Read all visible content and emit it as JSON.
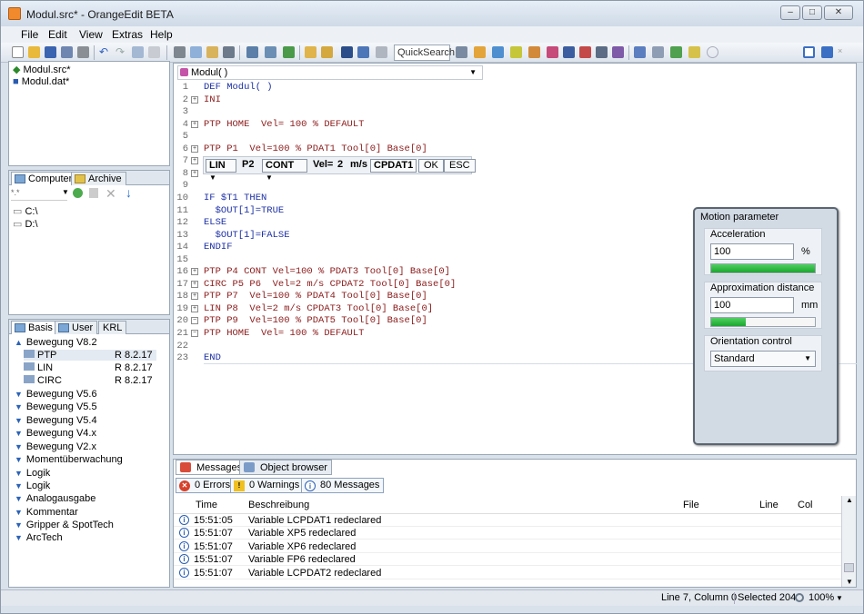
{
  "title": "Modul.src* - OrangeEdit BETA",
  "menu": [
    "File",
    "Edit",
    "View",
    "Extras",
    "Help"
  ],
  "toolbar": {
    "quicksearch": "QuickSearch"
  },
  "files": [
    "Modul.src*",
    "Modul.dat*"
  ],
  "browser": {
    "tabs": [
      "Computer",
      "Archive"
    ],
    "filter": "*.*",
    "drives": [
      "C:\\",
      "D:\\"
    ]
  },
  "library": {
    "tabs": [
      "Basis",
      "User",
      "KRL"
    ],
    "groups": [
      {
        "label": "Bewegung V8.2",
        "expanded": true,
        "items": [
          {
            "name": "PTP",
            "version": "R 8.2.17"
          },
          {
            "name": "LIN",
            "version": "R 8.2.17"
          },
          {
            "name": "CIRC",
            "version": "R 8.2.17"
          }
        ]
      },
      {
        "label": "Bewegung V5.6"
      },
      {
        "label": "Bewegung V5.5"
      },
      {
        "label": "Bewegung V5.4"
      },
      {
        "label": "Bewegung V4.x"
      },
      {
        "label": "Bewegung V2.x"
      },
      {
        "label": "Momentüberwachung"
      },
      {
        "label": "Logik"
      },
      {
        "label": "Logik"
      },
      {
        "label": "Analogausgabe"
      },
      {
        "label": "Kommentar"
      },
      {
        "label": "Gripper & SpotTech"
      },
      {
        "label": "ArcTech"
      }
    ]
  },
  "editor": {
    "function": "Modul( )",
    "lines": [
      {
        "n": "1",
        "t": "DEF Modul( )"
      },
      {
        "n": "2",
        "t": "INI",
        "fold": "+"
      },
      {
        "n": "3",
        "t": ""
      },
      {
        "n": "4",
        "t": "PTP HOME  Vel= 100 % DEFAULT",
        "fold": "+"
      },
      {
        "n": "5",
        "t": ""
      },
      {
        "n": "6",
        "t": "PTP P1  Vel=100 % PDAT1 Tool[0] Base[0]",
        "fold": "+"
      },
      {
        "n": "7",
        "t": "",
        "fold": "+"
      },
      {
        "n": "8",
        "t": "",
        "fold": "+"
      },
      {
        "n": "9",
        "t": ""
      },
      {
        "n": "10",
        "t": "IF $T1 THEN"
      },
      {
        "n": "11",
        "t": "  $OUT[1]=TRUE"
      },
      {
        "n": "12",
        "t": "ELSE"
      },
      {
        "n": "13",
        "t": "  $OUT[1]=FALSE"
      },
      {
        "n": "14",
        "t": "ENDIF"
      },
      {
        "n": "15",
        "t": ""
      },
      {
        "n": "16",
        "t": "PTP P4 CONT Vel=100 % PDAT3 Tool[0] Base[0]",
        "fold": "+"
      },
      {
        "n": "17",
        "t": "CIRC P5 P6  Vel=2 m/s CPDAT2 Tool[0] Base[0]",
        "fold": "+"
      },
      {
        "n": "18",
        "t": "PTP P7  Vel=100 % PDAT4 Tool[0] Base[0]",
        "fold": "+"
      },
      {
        "n": "19",
        "t": "LIN P8  Vel=2 m/s CPDAT3 Tool[0] Base[0]",
        "fold": "+"
      },
      {
        "n": "20",
        "t": "PTP P9  Vel=100 % PDAT5 Tool[0] Base[0]",
        "fold": "-"
      },
      {
        "n": "21",
        "t": "PTP HOME  Vel= 100 % DEFAULT",
        "fold": "-"
      },
      {
        "n": "22",
        "t": ""
      },
      {
        "n": "23",
        "t": "END"
      }
    ],
    "inline_form": {
      "motion": "LIN",
      "point": "P2",
      "approx": "CONT",
      "vel_label": "Vel=",
      "vel": "2",
      "unit": "m/s",
      "dataset": "CPDAT1",
      "ok": "OK",
      "esc": "ESC"
    }
  },
  "motion_parameter": {
    "title": "Motion parameter",
    "acceleration": {
      "label": "Acceleration",
      "value": "100",
      "unit": "%",
      "level": 1.0
    },
    "approximation": {
      "label": "Approximation distance",
      "value": "100",
      "unit": "mm",
      "level": 0.33
    },
    "orientation": {
      "label": "Orientation control",
      "value": "Standard"
    }
  },
  "messages": {
    "tabs": [
      "Messages",
      "Object browser"
    ],
    "filters": [
      "0 Errors",
      "0 Warnings",
      "80 Messages"
    ],
    "columns": [
      "Time",
      "Beschreibung",
      "File",
      "Line",
      "Col"
    ],
    "rows": [
      {
        "time": "15:51:05",
        "text": "Variable LCPDAT1 redeclared"
      },
      {
        "time": "15:51:07",
        "text": "Variable XP5 redeclared"
      },
      {
        "time": "15:51:07",
        "text": "Variable XP6 redeclared"
      },
      {
        "time": "15:51:07",
        "text": "Variable FP6 redeclared"
      },
      {
        "time": "15:51:07",
        "text": "Variable LCPDAT2 redeclared"
      }
    ]
  },
  "status": {
    "position": "Line 7, Column 0",
    "selected": "Selected 204",
    "zoom": "100%"
  }
}
